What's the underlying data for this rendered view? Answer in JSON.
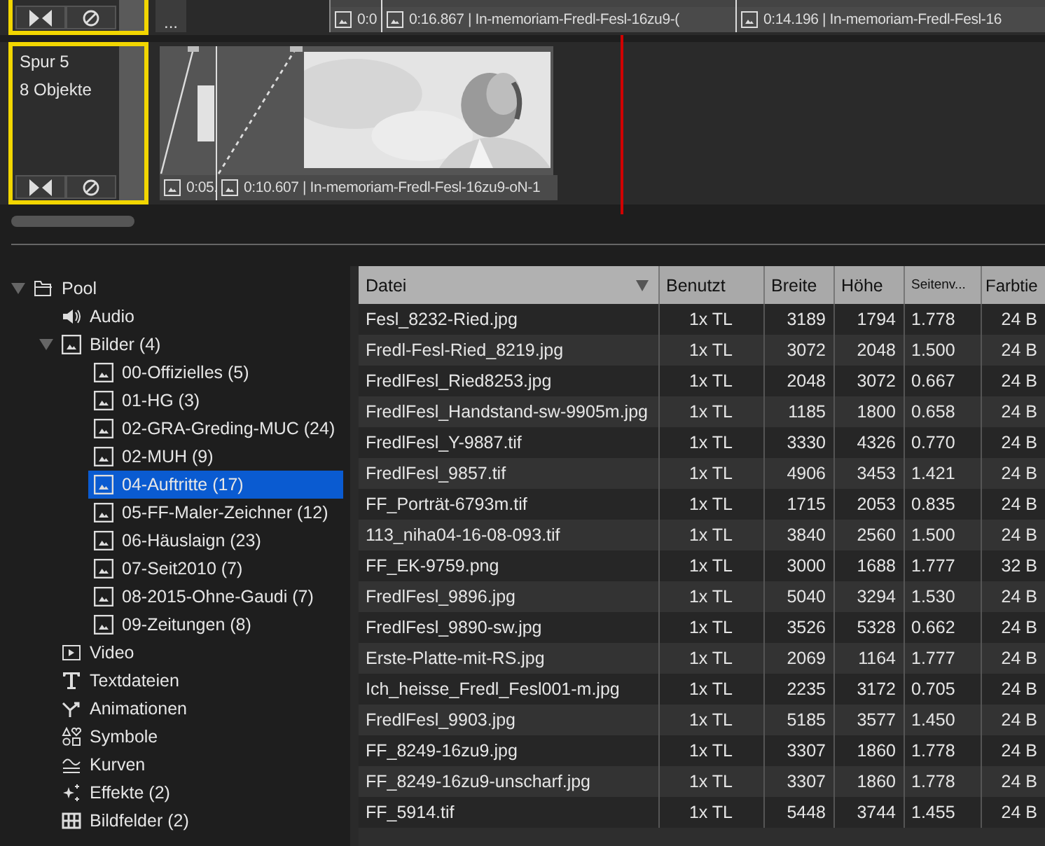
{
  "timeline": {
    "upper_track": {
      "selected": true,
      "more_label": "...",
      "clips": [
        {
          "label": "0:0"
        },
        {
          "label": "0:16.867 | In-memoriam-Fredl-Fesl-16zu9-("
        },
        {
          "label": "0:14.196 | In-memoriam-Fredl-Fesl-16"
        }
      ]
    },
    "track": {
      "name": "Spur 5",
      "count": "8 Objekte",
      "selected": true,
      "clips": [
        {
          "kind": "transition",
          "label": "0:05."
        },
        {
          "kind": "picture",
          "label": "0:10.607 | In-memoriam-Fredl-Fesl-16zu9-oN-1"
        }
      ]
    }
  },
  "pool": {
    "label": "Pool",
    "expanded": true,
    "children": [
      {
        "kind": "audio",
        "label": "Audio"
      },
      {
        "kind": "images",
        "label": "Bilder (4)",
        "expanded": true,
        "children": [
          {
            "label": "00-Offizielles (5)",
            "selected": false
          },
          {
            "label": "01-HG (3)",
            "selected": false
          },
          {
            "label": "02-GRA-Greding-MUC (24)",
            "selected": false
          },
          {
            "label": "02-MUH (9)",
            "selected": false
          },
          {
            "label": "04-Auftritte (17)",
            "selected": true
          },
          {
            "label": "05-FF-Maler-Zeichner (12)",
            "selected": false
          },
          {
            "label": "06-Häuslaign (23)",
            "selected": false
          },
          {
            "label": "07-Seit2010 (7)",
            "selected": false
          },
          {
            "label": "08-2015-Ohne-Gaudi (7)",
            "selected": false
          },
          {
            "label": "09-Zeitungen (8)",
            "selected": false
          }
        ]
      },
      {
        "kind": "video",
        "label": "Video"
      },
      {
        "kind": "text",
        "label": "Textdateien"
      },
      {
        "kind": "animation",
        "label": "Animationen"
      },
      {
        "kind": "symbols",
        "label": "Symbole"
      },
      {
        "kind": "curves",
        "label": "Kurven"
      },
      {
        "kind": "effects",
        "label": "Effekte (2)"
      },
      {
        "kind": "grid",
        "label": "Bildfelder (2)"
      }
    ]
  },
  "table": {
    "columns": [
      {
        "label": "Datei",
        "sorted": true
      },
      {
        "label": "Benutzt",
        "sorted": false
      },
      {
        "label": "Breite",
        "sorted": false
      },
      {
        "label": "Höhe",
        "sorted": false
      },
      {
        "label": "Seitenv...",
        "sorted": false
      },
      {
        "label": "Farbtie",
        "sorted": false
      }
    ],
    "rows": [
      [
        "Fesl_8232-Ried.jpg",
        "1x TL",
        "3189",
        "1794",
        "1.778",
        "24 B"
      ],
      [
        "Fredl-Fesl-Ried_8219.jpg",
        "1x TL",
        "3072",
        "2048",
        "1.500",
        "24 B"
      ],
      [
        "FredlFesl_Ried8253.jpg",
        "1x TL",
        "2048",
        "3072",
        "0.667",
        "24 B"
      ],
      [
        "FredlFesl_Handstand-sw-9905m.jpg",
        "1x TL",
        "1185",
        "1800",
        "0.658",
        "24 B"
      ],
      [
        "FredlFesl_Y-9887.tif",
        "1x TL",
        "3330",
        "4326",
        "0.770",
        "24 B"
      ],
      [
        "FredlFesl_9857.tif",
        "1x TL",
        "4906",
        "3453",
        "1.421",
        "24 B"
      ],
      [
        "FF_Porträt-6793m.tif",
        "1x TL",
        "1715",
        "2053",
        "0.835",
        "24 B"
      ],
      [
        "113_niha04-16-08-093.tif",
        "1x TL",
        "3840",
        "2560",
        "1.500",
        "24 B"
      ],
      [
        "FF_EK-9759.png",
        "1x TL",
        "3000",
        "1688",
        "1.777",
        "32 B"
      ],
      [
        "FredlFesl_9896.jpg",
        "1x TL",
        "5040",
        "3294",
        "1.530",
        "24 B"
      ],
      [
        "FredlFesl_9890-sw.jpg",
        "1x TL",
        "3526",
        "5328",
        "0.662",
        "24 B"
      ],
      [
        "Erste-Platte-mit-RS.jpg",
        "1x TL",
        "2069",
        "1164",
        "1.777",
        "24 B"
      ],
      [
        "Ich_heisse_Fredl_Fesl001-m.jpg",
        "1x TL",
        "2235",
        "3172",
        "0.705",
        "24 B"
      ],
      [
        "FredlFesl_9903.jpg",
        "1x TL",
        "5185",
        "3577",
        "1.450",
        "24 B"
      ],
      [
        "FF_8249-16zu9.jpg",
        "1x TL",
        "3307",
        "1860",
        "1.778",
        "24 B"
      ],
      [
        "FF_8249-16zu9-unscharf.jpg",
        "1x TL",
        "3307",
        "1860",
        "1.778",
        "24 B"
      ],
      [
        "FF_5914.tif",
        "1x TL",
        "5448",
        "3744",
        "1.455",
        "24 B"
      ]
    ]
  }
}
